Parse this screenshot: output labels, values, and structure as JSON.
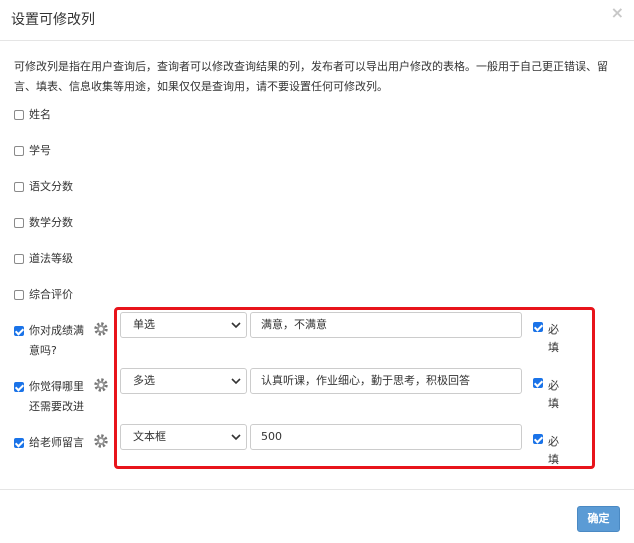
{
  "dialog": {
    "title": "设置可修改列",
    "close_icon": "×",
    "description": "可修改列是指在用户查询后，查询者可以修改查询结果的列，发布者可以导出用户修改的表格。一般用于自己更正错误、留言、填表、信息收集等用途，如果仅仅是查询用，请不要设置任何可修改列。"
  },
  "columns": [
    {
      "label": "姓名",
      "checked": false
    },
    {
      "label": "学号",
      "checked": false
    },
    {
      "label": "语文分数",
      "checked": false
    },
    {
      "label": "数学分数",
      "checked": false
    },
    {
      "label": "道法等级",
      "checked": false
    },
    {
      "label": "综合评价",
      "checked": false
    },
    {
      "label": "你对成绩满意吗?",
      "checked": true,
      "type": "单选",
      "options": "满意，不满意",
      "required_label": "必填",
      "required": true
    },
    {
      "label": "你觉得哪里还需要改进",
      "checked": true,
      "type": "多选",
      "options": "认真听课，作业细心，勤于思考，积极回答",
      "required_label": "必填",
      "required": true
    },
    {
      "label": "给老师留言",
      "checked": true,
      "type": "文本框",
      "options": "500",
      "required_label": "必填",
      "required": true
    }
  ],
  "footer": {
    "confirm_label": "确定"
  },
  "colors": {
    "accent": "#1a73e8",
    "highlight": "#e8141b",
    "button": "#5b9bd5"
  }
}
